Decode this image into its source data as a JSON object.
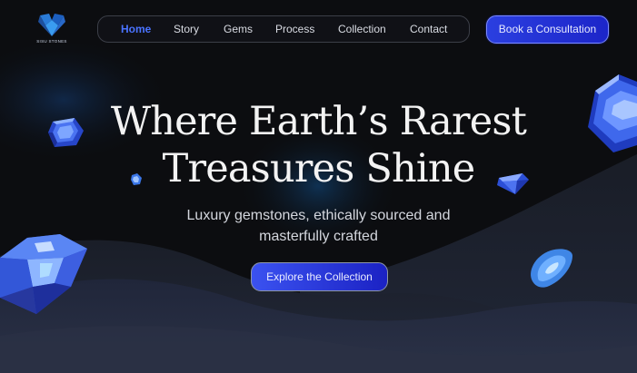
{
  "brand": {
    "logo_text": "SISU STONES"
  },
  "nav": {
    "items": [
      {
        "label": "Home",
        "active": true
      },
      {
        "label": "Story",
        "active": false
      },
      {
        "label": "Gems",
        "active": false
      },
      {
        "label": "Process",
        "active": false
      },
      {
        "label": "Collection",
        "active": false
      },
      {
        "label": "Contact",
        "active": false
      }
    ]
  },
  "header": {
    "cta_label": "Book a Consultation"
  },
  "hero": {
    "title_line1": "Where Earth’s Rarest",
    "title_line2": "Treasures Shine",
    "subtitle_line1": "Luxury gemstones, ethically sourced and",
    "subtitle_line2": "masterfully crafted",
    "cta_label": "Explore the Collection"
  },
  "colors": {
    "background": "#0c0d10",
    "accent": "#2b3fe0",
    "nav_active": "#4a73ff",
    "wave": "#1d2230",
    "gem_blue": "#3a6cff"
  },
  "icons": [
    "sapphire-gem-icon",
    "diamond-gem-icon",
    "pear-gem-icon",
    "emerald-cut-gem-icon",
    "logo-gem-icon"
  ]
}
